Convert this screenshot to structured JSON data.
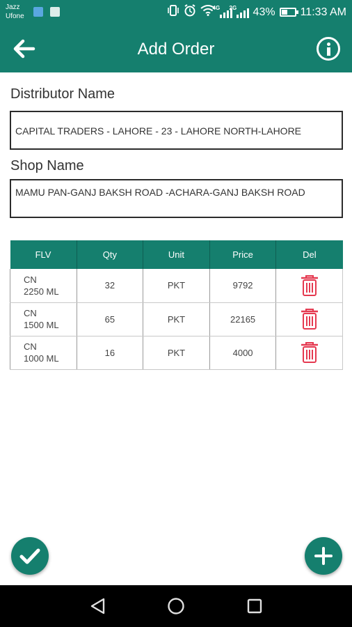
{
  "status_bar": {
    "carrier_1": "Jazz",
    "carrier_2": "Ufone",
    "network_1": "4G",
    "network_2": "2G",
    "battery_percent": "43%",
    "battery_level": 0.43,
    "time": "11:33 AM"
  },
  "app_bar": {
    "title": "Add Order",
    "back_icon": "arrow-left-icon",
    "info_icon": "info-icon",
    "color": "#157f6e"
  },
  "form": {
    "distributor_label": "Distributor Name",
    "distributor_value": "CAPITAL TRADERS - LAHORE - 23 - LAHORE NORTH-LAHORE",
    "shop_label": "Shop Name",
    "shop_value": "MAMU PAN-GANJ BAKSH ROAD -ACHARA-GANJ BAKSH ROAD"
  },
  "table": {
    "headers": [
      "FLV",
      "Qty",
      "Unit",
      "Price",
      "Del"
    ],
    "rows": [
      {
        "flv_line1": "CN",
        "flv_line2": "2250 ML",
        "qty": "32",
        "unit": "PKT",
        "price": "9792"
      },
      {
        "flv_line1": "CN",
        "flv_line2": "1500 ML",
        "qty": "65",
        "unit": "PKT",
        "price": "22165"
      },
      {
        "flv_line1": "CN",
        "flv_line2": "1000 ML",
        "qty": "16",
        "unit": "PKT",
        "price": "4000"
      }
    ],
    "delete_icon": "trash-icon",
    "delete_color": "#e53950"
  },
  "fabs": {
    "confirm_icon": "check-icon",
    "add_icon": "plus-icon"
  },
  "nav_bar": {
    "back_icon": "triangle-back-icon",
    "home_icon": "circle-home-icon",
    "recents_icon": "square-recents-icon"
  }
}
